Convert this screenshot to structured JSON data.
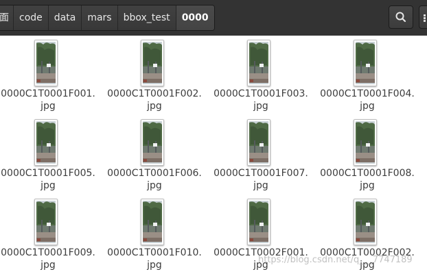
{
  "header": {
    "breadcrumbs": [
      "面",
      "code",
      "data",
      "mars",
      "bbox_test",
      "0000"
    ],
    "search_icon": "search-icon",
    "menu_icon": "menu-icon"
  },
  "files": [
    {
      "name": "0000C1T0001F001.jpg"
    },
    {
      "name": "0000C1T0001F002.jpg"
    },
    {
      "name": "0000C1T0001F003.jpg"
    },
    {
      "name": "0000C1T0001F004.jpg"
    },
    {
      "name": "0000C1T0001F005.jpg"
    },
    {
      "name": "0000C1T0001F006.jpg"
    },
    {
      "name": "0000C1T0001F007.jpg"
    },
    {
      "name": "0000C1T0001F008.jpg"
    },
    {
      "name": "0000C1T0001F009.jpg"
    },
    {
      "name": "0000C1T0001F010.jpg"
    },
    {
      "name": "0000C1T0002F001.jpg"
    },
    {
      "name": "0000C1T0002F002.jpg"
    }
  ],
  "watermark": "https://blog.csdn.net/q___7747189",
  "colors": {
    "header_bg": "#333333",
    "folder_text": "#3c3c3c",
    "thumb_tree": "#4f6a45",
    "thumb_sky": "#c9d2d6"
  }
}
